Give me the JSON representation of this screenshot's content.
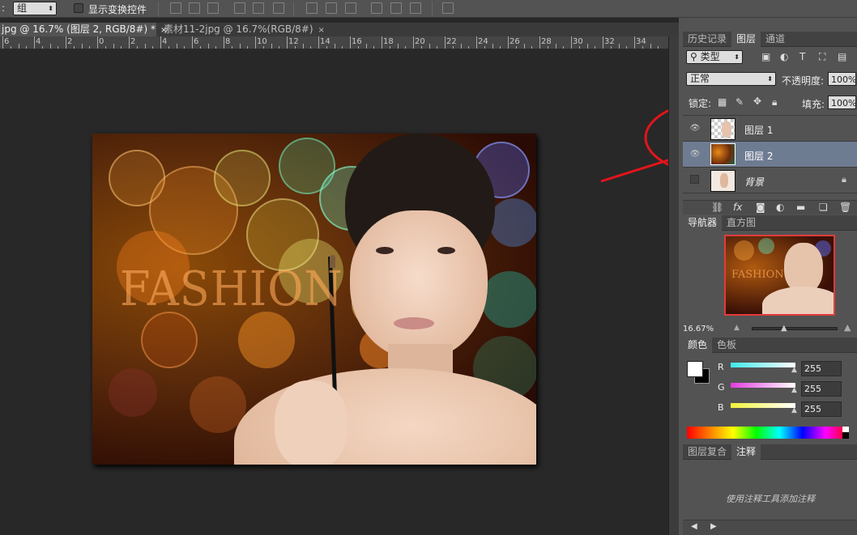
{
  "optbar": {
    "partial_label": ":",
    "group_select": "组",
    "show_transform_label": "显示变换控件"
  },
  "tabs": [
    {
      "label": "jpg @ 16.7% (图层 2, RGB/8#) *",
      "close": "×"
    },
    {
      "label": "素材11-2jpg @ 16.7%(RGB/8#)",
      "close": "×"
    }
  ],
  "ruler": {
    "labels": [
      "6",
      "4",
      "2",
      "0",
      "2",
      "4",
      "6",
      "8",
      "10",
      "12",
      "14",
      "16",
      "18",
      "20",
      "22",
      "24",
      "26",
      "28",
      "30",
      "32",
      "34"
    ]
  },
  "image": {
    "overlay_text": "FASHION"
  },
  "layers_panel": {
    "tabs": [
      "历史记录",
      "图层",
      "通道"
    ],
    "active_tab": "图层",
    "filter_kind": "类型",
    "blend_mode": "正常",
    "opacity_label": "不透明度:",
    "opacity_value": "100%",
    "lock_label": "锁定:",
    "fill_label": "填充:",
    "fill_value": "100%",
    "layers": [
      {
        "name": "图层 1",
        "visible": true,
        "selected": false,
        "locked": false
      },
      {
        "name": "图层 2",
        "visible": true,
        "selected": true,
        "locked": false
      },
      {
        "name": "背景",
        "visible": false,
        "selected": false,
        "locked": true
      }
    ]
  },
  "navigator_panel": {
    "tabs": [
      "导航器",
      "直方图"
    ],
    "active_tab": "导航器",
    "zoom": "16.67%"
  },
  "color_panel": {
    "tabs": [
      "颜色",
      "色板"
    ],
    "active_tab": "颜色",
    "channels": [
      {
        "label": "R",
        "value": "255",
        "color": "#3fe9ea"
      },
      {
        "label": "G",
        "value": "255",
        "color": "#e23be0"
      },
      {
        "label": "B",
        "value": "255",
        "color": "#f2f23a"
      }
    ]
  },
  "notes_panel": {
    "tabs": [
      "图层复合",
      "注释"
    ],
    "active_tab": "注释",
    "placeholder": "使用注释工具添加注释"
  },
  "annotation": {
    "color": "#e4141b"
  }
}
